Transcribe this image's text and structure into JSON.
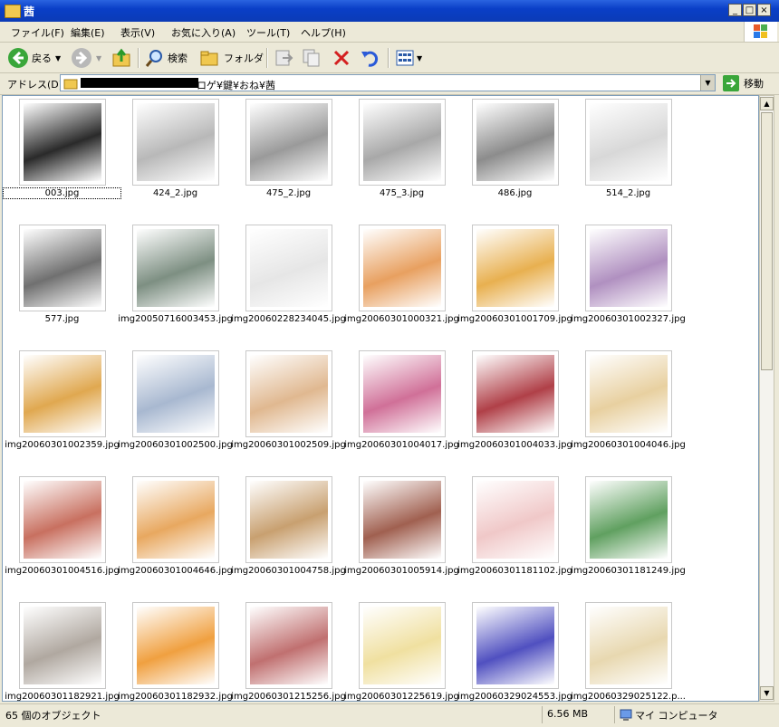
{
  "window": {
    "title": "茜"
  },
  "menu": [
    "ファイル(F)",
    "編集(E)",
    "表示(V)",
    "お気に入り(A)",
    "ツール(T)",
    "ヘルプ(H)"
  ],
  "toolbar": {
    "back_label": "戻る",
    "search_label": "検索",
    "folders_label": "フォルダ"
  },
  "address": {
    "label": "アドレス(D)",
    "path": "ロゲ¥鍵¥おね¥茜",
    "go_label": "移動"
  },
  "files": [
    {
      "name": "003.jpg",
      "color": "#2a2a2a"
    },
    {
      "name": "424_2.jpg",
      "color": "#b8b8b8"
    },
    {
      "name": "475_2.jpg",
      "color": "#9a9a9a"
    },
    {
      "name": "475_3.jpg",
      "color": "#a8a8a8"
    },
    {
      "name": "486.jpg",
      "color": "#8c8c8c"
    },
    {
      "name": "514_2.jpg",
      "color": "#d8d8d8"
    },
    {
      "name": "577.jpg",
      "color": "#707070"
    },
    {
      "name": "img20050716003453.jpg",
      "color": "#7d8f82"
    },
    {
      "name": "img20060228234045.jpg",
      "color": "#e6e6e6"
    },
    {
      "name": "img20060301000321.jpg",
      "color": "#e8a060"
    },
    {
      "name": "img20060301001709.jpg",
      "color": "#e8b050"
    },
    {
      "name": "img20060301002327.jpg",
      "color": "#b090c0"
    },
    {
      "name": "img20060301002359.jpg",
      "color": "#e0a850"
    },
    {
      "name": "img20060301002500.jpg",
      "color": "#a8b8d0"
    },
    {
      "name": "img20060301002509.jpg",
      "color": "#e0b890"
    },
    {
      "name": "img20060301004017.jpg",
      "color": "#d07098"
    },
    {
      "name": "img20060301004033.jpg",
      "color": "#b04048"
    },
    {
      "name": "img20060301004046.jpg",
      "color": "#e8d0a0"
    },
    {
      "name": "img20060301004516.jpg",
      "color": "#c87060"
    },
    {
      "name": "img20060301004646.jpg",
      "color": "#e8a860"
    },
    {
      "name": "img20060301004758.jpg",
      "color": "#c8a070"
    },
    {
      "name": "img20060301005914.jpg",
      "color": "#a06050"
    },
    {
      "name": "img20060301181102.jpg",
      "color": "#f0c8c8"
    },
    {
      "name": "img20060301181249.jpg",
      "color": "#60a060"
    },
    {
      "name": "img20060301182921.jpg",
      "color": "#b0a8a0"
    },
    {
      "name": "img20060301182932.jpg",
      "color": "#f0a040"
    },
    {
      "name": "img20060301215256.jpg",
      "color": "#c07070"
    },
    {
      "name": "img20060301225619.jpg",
      "color": "#f0e0a0"
    },
    {
      "name": "img20060329024553.jpg",
      "color": "#5050c0"
    },
    {
      "name": "img20060329025122.p...",
      "color": "#e8d8b0"
    }
  ],
  "status": {
    "count": "65 個のオブジェクト",
    "size": "6.56 MB",
    "location": "マイ コンピュータ"
  }
}
